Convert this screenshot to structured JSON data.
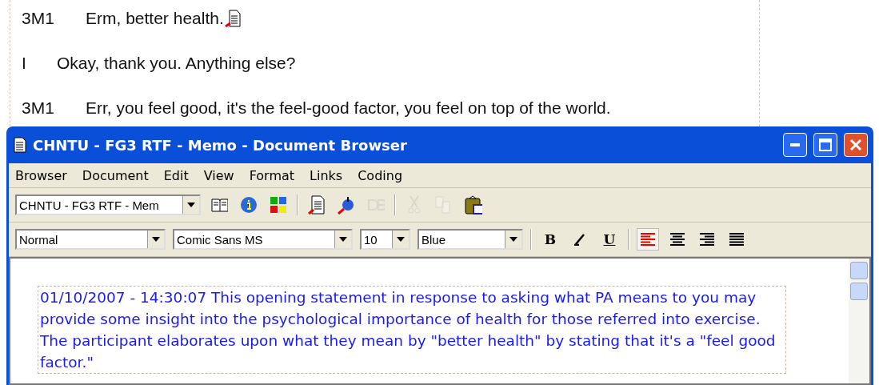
{
  "transcript": [
    {
      "speaker": "3M1",
      "text": "Erm, better health.",
      "memo_mark": true
    },
    {
      "speaker": "I",
      "text": "Okay, thank you.  Anything else?",
      "memo_mark": false
    },
    {
      "speaker": "3M1",
      "text": "Err, you feel good, it's the feel-good factor, you feel on top of the world.",
      "memo_mark": false
    }
  ],
  "window": {
    "title": "CHNTU - FG3 RTF - Memo - Document Browser"
  },
  "menu": [
    "Browser",
    "Document",
    "Edit",
    "View",
    "Format",
    "Links",
    "Coding"
  ],
  "toolbar": {
    "document": "CHNTU - FG3 RTF - Mem",
    "groups": [
      [
        {
          "kind": "book",
          "disabled": false
        },
        {
          "kind": "info",
          "disabled": false
        },
        {
          "kind": "grid",
          "disabled": false
        }
      ],
      [
        {
          "kind": "doclink",
          "disabled": false
        },
        {
          "kind": "pin",
          "disabled": false
        },
        {
          "kind": "db",
          "disabled": true
        }
      ],
      [
        {
          "kind": "cut",
          "disabled": true
        },
        {
          "kind": "copy",
          "disabled": true
        },
        {
          "kind": "paste",
          "disabled": false
        }
      ]
    ]
  },
  "format": {
    "style": "Normal",
    "font": "Comic Sans MS",
    "size": "10",
    "text_color": "Blue",
    "bold": "B",
    "underline": "U",
    "align": [
      {
        "kind": "left",
        "selected": true
      },
      {
        "kind": "center",
        "selected": false
      },
      {
        "kind": "right",
        "selected": false
      },
      {
        "kind": "justify",
        "selected": false
      }
    ]
  },
  "memo": {
    "text": "01/10/2007 - 14:30:07 This opening statement in response to asking what PA means to you may provide some insight into the psychological importance of health for those referred into exercise. The participant elaborates upon what they mean by \"better health\" by stating that it's a \"feel good factor.\""
  }
}
